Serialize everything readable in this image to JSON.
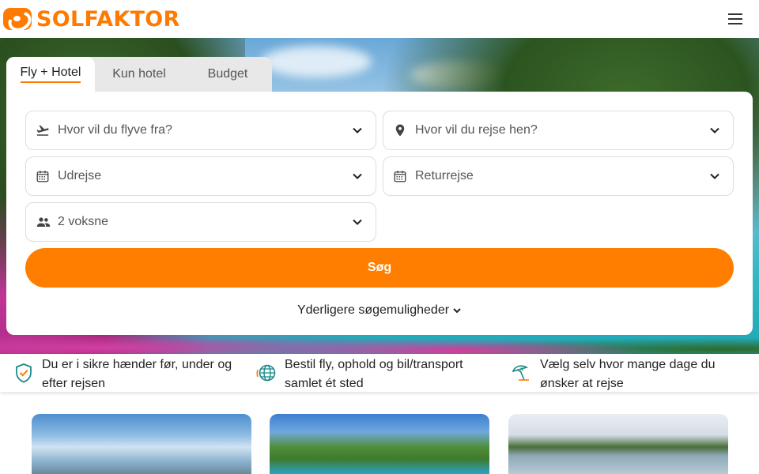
{
  "brand": {
    "name": "SOLFAKTOR",
    "accent_color": "#ff7a00"
  },
  "header": {
    "menu_icon": "hamburger-menu-icon"
  },
  "tabs": [
    {
      "label": "Fly + Hotel",
      "active": true
    },
    {
      "label": "Kun hotel",
      "active": false
    },
    {
      "label": "Budget",
      "active": false
    }
  ],
  "search": {
    "departure": {
      "placeholder": "Hvor vil du flyve fra?",
      "icon": "plane-icon"
    },
    "destination": {
      "placeholder": "Hvor vil du rejse hen?",
      "icon": "location-pin-icon"
    },
    "outbound": {
      "placeholder": "Udrejse",
      "icon": "calendar-icon"
    },
    "return": {
      "placeholder": "Returrejse",
      "icon": "calendar-icon"
    },
    "travellers": {
      "value": "2 voksne",
      "icon": "people-icon"
    },
    "submit_label": "Søg",
    "more_options_label": "Yderligere søgemuligheder"
  },
  "benefits": [
    {
      "icon": "shield-check-icon",
      "text": "Du er i sikre hænder før, under og efter rejsen"
    },
    {
      "icon": "globe-icon",
      "text": "Bestil fly, ophold og bil/transport samlet ét sted"
    },
    {
      "icon": "beach-umbrella-icon",
      "text": "Vælg selv hvor mange dage du ønsker at rejse"
    }
  ]
}
